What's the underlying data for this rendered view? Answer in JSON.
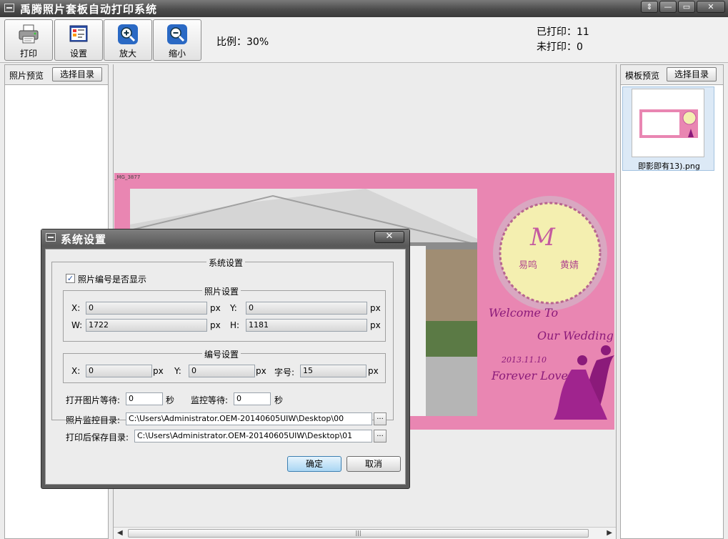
{
  "window": {
    "title": "禹腾照片套板自动打印系统",
    "buttons": [
      "⇕",
      "—",
      "▭",
      "✕"
    ]
  },
  "toolbar": {
    "buttons": [
      {
        "label": "打印",
        "icon": "printer-icon"
      },
      {
        "label": "设置",
        "icon": "settings-icon"
      },
      {
        "label": "放大",
        "icon": "zoom-in-icon"
      },
      {
        "label": "缩小",
        "icon": "zoom-out-icon"
      }
    ],
    "scale": "比例：30%",
    "printed": "已打印：11",
    "unprinted": "未打印：0"
  },
  "left_panel": {
    "label": "照片预览",
    "button": "选择目录"
  },
  "right_panel": {
    "label": "模板预览",
    "button": "选择目录",
    "thumb_caption": "即影即有13).png"
  },
  "preview": {
    "filename": "_MG_3877",
    "texts": {
      "monogram": "M",
      "name_left": "易鸣",
      "name_right": "黄婧",
      "welcome": "Welcome To",
      "our_wedding": "Our Wedding",
      "date": "2013.11.10",
      "forever": "Forever Love"
    }
  },
  "dialog": {
    "title": "系统设置",
    "close": "✕",
    "group_main": "系统设置",
    "show_number_label": "照片编号是否显示",
    "show_number_checked": "✓",
    "photo_group": "照片设置",
    "photo": {
      "x_label": "X:",
      "x": "0",
      "y_label": "Y:",
      "y": "0",
      "w_label": "W:",
      "w": "1722",
      "h_label": "H:",
      "h": "1181",
      "unit": "px"
    },
    "number_group": "编号设置",
    "number": {
      "x_label": "X:",
      "x": "0",
      "y_label": "Y:",
      "y": "0",
      "font_label": "字号:",
      "font": "15",
      "unit": "px"
    },
    "open_wait_label": "打开图片等待:",
    "open_wait": "0",
    "sec": "秒",
    "monitor_wait_label": "监控等待:",
    "monitor_wait": "0",
    "monitor_dir_label": "照片监控目录:",
    "monitor_dir": "C:\\Users\\Administrator.OEM-20140605UIW\\Desktop\\00",
    "save_dir_label": "打印后保存目录:",
    "save_dir": "C:\\Users\\Administrator.OEM-20140605UIW\\Desktop\\01",
    "browse": "...",
    "ok": "确定",
    "cancel": "取消"
  },
  "scrollbar": {
    "left": "◀",
    "right": "▶",
    "grip": "|||"
  }
}
